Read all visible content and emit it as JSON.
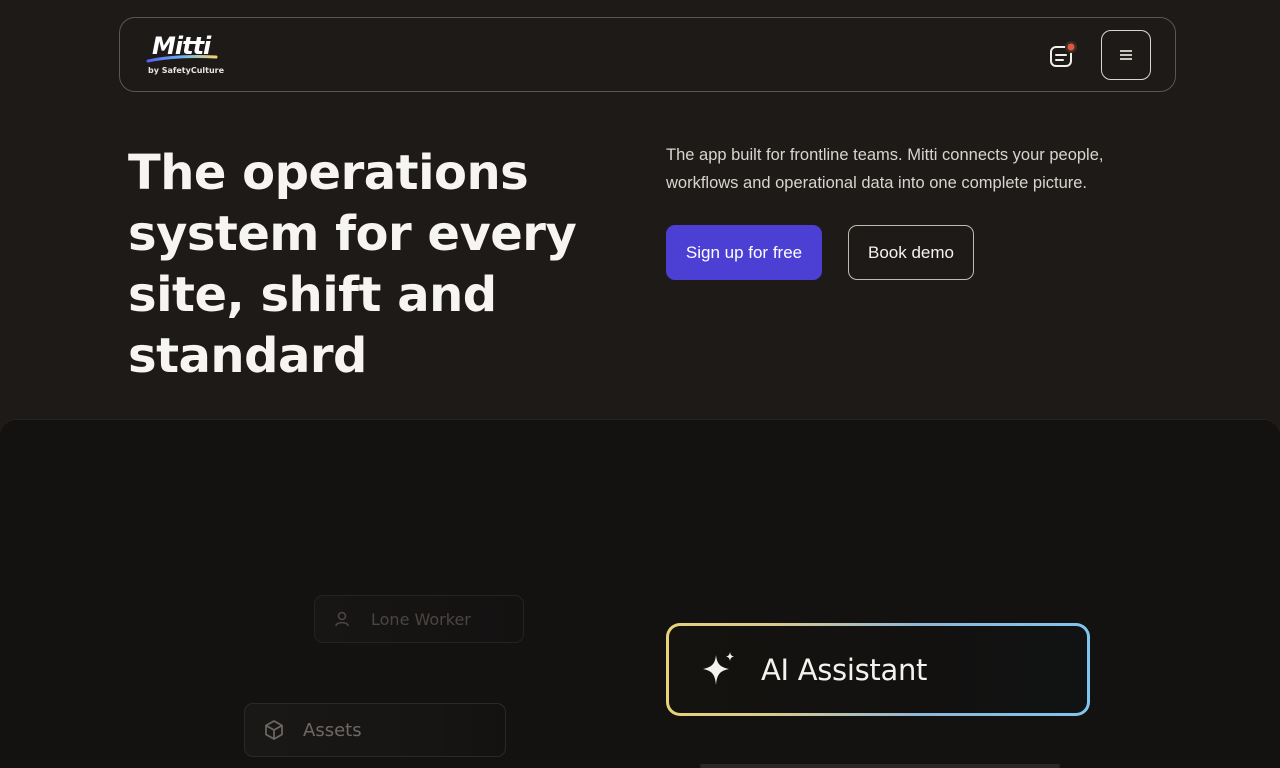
{
  "header": {
    "logo_text": "Mitti",
    "logo_sub": "by SafetyCulture",
    "chat_icon": "chat-notification-icon",
    "menu_icon": "hamburger-menu-icon"
  },
  "hero": {
    "title": "The operations system for every site, shift and standard",
    "description": "The app built for frontline teams. Mitti connects your people, workflows and operational data into one complete picture.",
    "primary_cta": "Sign up for free",
    "secondary_cta": "Book demo"
  },
  "showcase": {
    "pills": [
      {
        "label": "Lone Worker",
        "icon": "person-icon"
      },
      {
        "label": "Assets",
        "icon": "cube-icon"
      }
    ],
    "ai_card": {
      "label": "AI Assistant",
      "icon": "sparkle-icon"
    }
  },
  "colors": {
    "background": "#1d1a18",
    "showcase_bg": "#141211",
    "primary": "#4b3fd4",
    "notification_dot": "#e2563c"
  }
}
